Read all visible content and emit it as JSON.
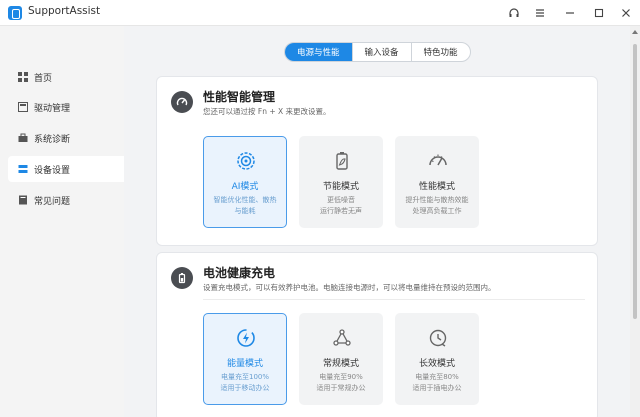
{
  "app": {
    "title": "SupportAssist"
  },
  "sidebar": {
    "items": [
      {
        "label": "首页",
        "icon": "grid-icon"
      },
      {
        "label": "驱动管理",
        "icon": "driver-icon"
      },
      {
        "label": "系统诊断",
        "icon": "toolbox-icon"
      },
      {
        "label": "设备设置",
        "icon": "device-settings-icon",
        "active": true
      },
      {
        "label": "常见问题",
        "icon": "book-icon"
      }
    ]
  },
  "tabs": [
    {
      "label": "电源与性能",
      "active": true
    },
    {
      "label": "输入设备"
    },
    {
      "label": "特色功能"
    }
  ],
  "performance": {
    "title": "性能智能管理",
    "subtitle": "您还可以通过按 Fn + X 来更改设置。",
    "modes": [
      {
        "name": "AI模式",
        "desc1": "智能优化性能、散热",
        "desc2": "与能耗",
        "selected": true
      },
      {
        "name": "节能模式",
        "desc1": "更低噪音",
        "desc2": "运行静若无声"
      },
      {
        "name": "性能模式",
        "desc1": "提升性能与散热效能",
        "desc2": "处理高负载工作"
      }
    ]
  },
  "battery": {
    "title": "电池健康充电",
    "subtitle": "设置充电模式，可以有效养护电池。电脑连接电源时，可以将电量维持在预设的范围内。",
    "modes": [
      {
        "name": "能量模式",
        "desc1": "电量充至100%",
        "desc2": "适用于移动办公",
        "selected": true
      },
      {
        "name": "常规模式",
        "desc1": "电量充至90%",
        "desc2": "适用于常规办公"
      },
      {
        "name": "长效模式",
        "desc1": "电量充至80%",
        "desc2": "适用于插电办公"
      }
    ]
  },
  "colors": {
    "accent": "#1e88e5",
    "selected_bg": "#eaf3fd"
  }
}
